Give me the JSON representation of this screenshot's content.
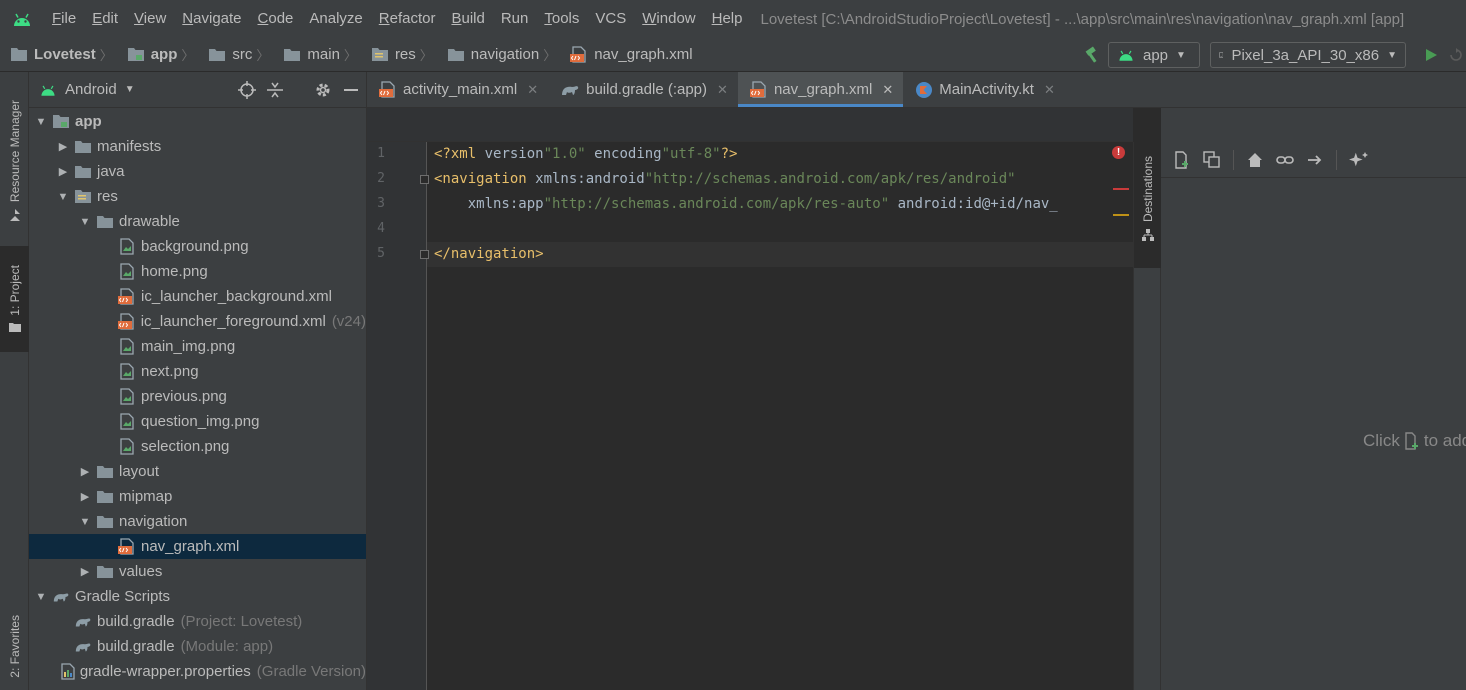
{
  "menubar": {
    "items": [
      {
        "u": "F",
        "rest": "ile"
      },
      {
        "u": "E",
        "rest": "dit"
      },
      {
        "u": "V",
        "rest": "iew"
      },
      {
        "u": "N",
        "rest": "avigate"
      },
      {
        "u": "C",
        "rest": "ode"
      },
      {
        "u": "",
        "rest": "Analyze"
      },
      {
        "u": "R",
        "rest": "efactor"
      },
      {
        "u": "B",
        "rest": "uild"
      },
      {
        "u": "",
        "rest": "Run"
      },
      {
        "u": "T",
        "rest": "ools"
      },
      {
        "u": "",
        "rest": "VCS"
      },
      {
        "u": "W",
        "rest": "indow"
      },
      {
        "u": "H",
        "rest": "elp"
      }
    ],
    "window_title": "Lovetest [C:\\AndroidStudioProject\\Lovetest] - ...\\app\\src\\main\\res\\navigation\\nav_graph.xml [app]"
  },
  "breadcrumb": [
    "Lovetest",
    "app",
    "src",
    "main",
    "res",
    "navigation",
    "nav_graph.xml"
  ],
  "run_config": {
    "module": "app",
    "device": "Pixel_3a_API_30_x86"
  },
  "project_panel": {
    "view_mode": "Android",
    "tree": [
      {
        "label": "app",
        "depth": 0,
        "toggle": "open",
        "icon": "module-folder-icon",
        "bold": true
      },
      {
        "label": "manifests",
        "depth": 1,
        "toggle": "closed",
        "icon": "folder-icon"
      },
      {
        "label": "java",
        "depth": 1,
        "toggle": "closed",
        "icon": "folder-icon"
      },
      {
        "label": "res",
        "depth": 1,
        "toggle": "open",
        "icon": "res-folder-icon"
      },
      {
        "label": "drawable",
        "depth": 2,
        "toggle": "open",
        "icon": "folder-icon"
      },
      {
        "label": "background.png",
        "depth": 3,
        "icon": "image-file-icon"
      },
      {
        "label": "home.png",
        "depth": 3,
        "icon": "image-file-icon"
      },
      {
        "label": "ic_launcher_background.xml",
        "depth": 3,
        "icon": "xml-file-icon"
      },
      {
        "label": "ic_launcher_foreground.xml",
        "depth": 3,
        "icon": "xml-file-icon",
        "suffix": "(v24)"
      },
      {
        "label": "main_img.png",
        "depth": 3,
        "icon": "image-file-icon"
      },
      {
        "label": "next.png",
        "depth": 3,
        "icon": "image-file-icon"
      },
      {
        "label": "previous.png",
        "depth": 3,
        "icon": "image-file-icon"
      },
      {
        "label": "question_img.png",
        "depth": 3,
        "icon": "image-file-icon"
      },
      {
        "label": "selection.png",
        "depth": 3,
        "icon": "image-file-icon"
      },
      {
        "label": "layout",
        "depth": 2,
        "toggle": "closed",
        "icon": "folder-icon"
      },
      {
        "label": "mipmap",
        "depth": 2,
        "toggle": "closed",
        "icon": "folder-icon"
      },
      {
        "label": "navigation",
        "depth": 2,
        "toggle": "open",
        "icon": "folder-icon"
      },
      {
        "label": "nav_graph.xml",
        "depth": 3,
        "icon": "xml-file-icon",
        "selected": true
      },
      {
        "label": "values",
        "depth": 2,
        "toggle": "closed",
        "icon": "folder-icon"
      },
      {
        "label": "Gradle Scripts",
        "depth": 0,
        "toggle": "open",
        "icon": "gradle-icon"
      },
      {
        "label": "build.gradle",
        "depth": 1,
        "icon": "gradle-icon",
        "suffix": "(Project: Lovetest)"
      },
      {
        "label": "build.gradle",
        "depth": 1,
        "icon": "gradle-icon",
        "suffix": "(Module: app)"
      },
      {
        "label": "gradle-wrapper.properties",
        "depth": 1,
        "icon": "properties-file-icon",
        "suffix": "(Gradle Version)"
      }
    ]
  },
  "side_tabs": {
    "resource_manager": "Resource Manager",
    "project": "1: Project",
    "favorites": "2: Favorites"
  },
  "editor_tabs": [
    {
      "label": "activity_main.xml",
      "icon": "xml-file-icon",
      "active": false
    },
    {
      "label": "build.gradle (:app)",
      "icon": "gradle-icon",
      "active": false
    },
    {
      "label": "nav_graph.xml",
      "icon": "xml-file-icon",
      "active": true
    },
    {
      "label": "MainActivity.kt",
      "icon": "kotlin-file-icon",
      "active": false
    }
  ],
  "editor": {
    "line_numbers": [
      "1",
      "2",
      "3",
      "4",
      "5"
    ],
    "lines": [
      "<?xml version=\"1.0\" encoding=\"utf-8\"?>",
      "<navigation xmlns:android=\"http://schemas.android.com/apk/res/android\"",
      "    xmlns:app=\"http://schemas.android.com/apk/res-auto\" android:id=\"@+id/nav_",
      "",
      "</navigation>"
    ]
  },
  "destinations_tab": "Destinations",
  "design_panel": {
    "empty_text_before": "Click",
    "empty_text_after": "to add"
  },
  "colors": {
    "accent": "#4a88c7",
    "android_green": "#3ddc84",
    "xml_orange": "#e06c3c"
  }
}
